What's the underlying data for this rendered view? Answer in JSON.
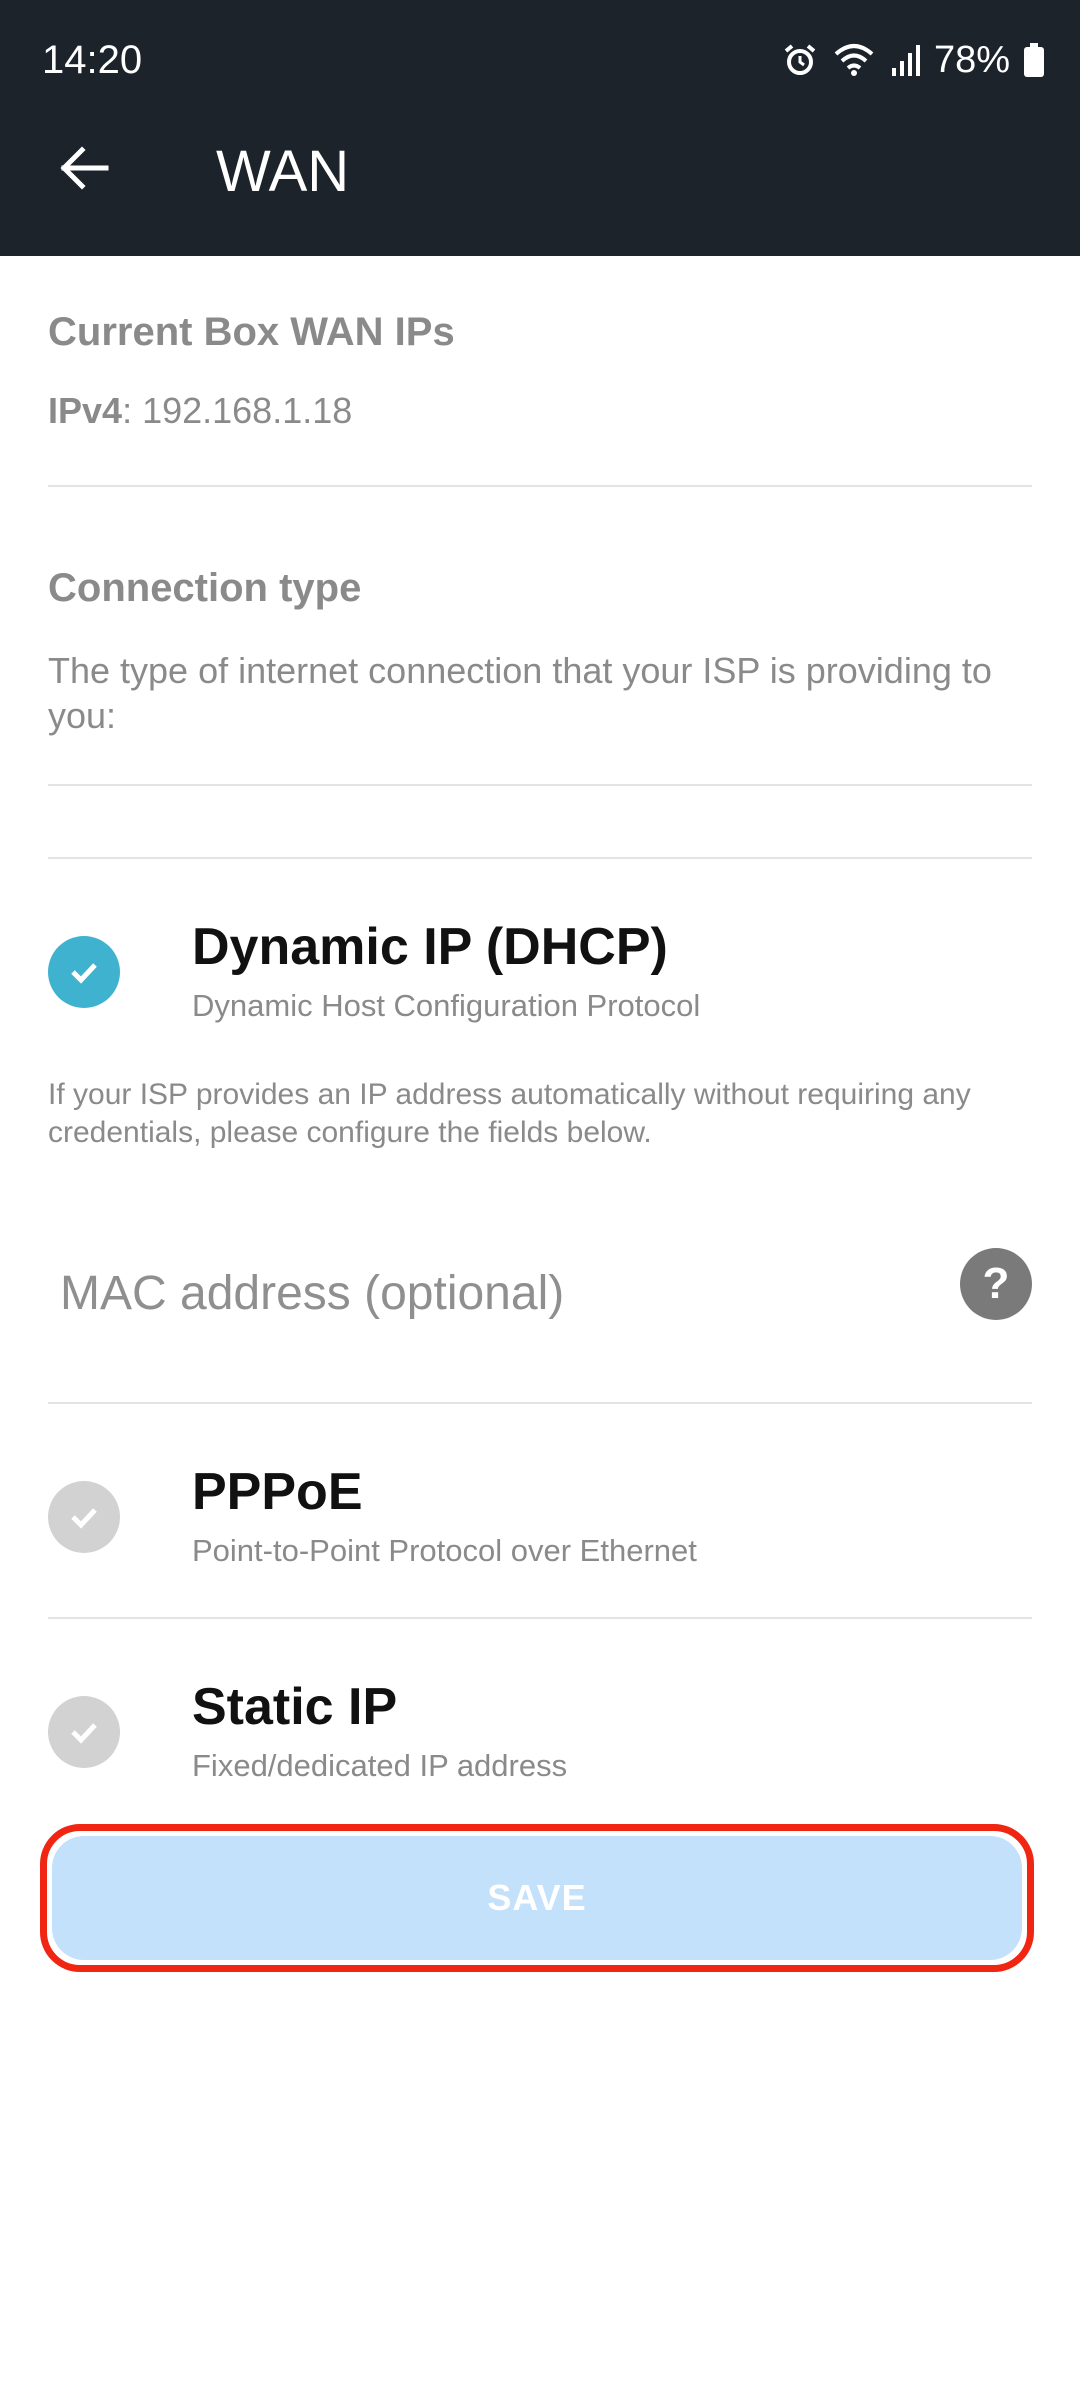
{
  "status_bar": {
    "time": "14:20",
    "battery": "78%",
    "icons": [
      "alarm-icon",
      "wifi-icon",
      "signal-icon",
      "battery-icon"
    ]
  },
  "app_bar": {
    "title": "WAN",
    "back_icon": "arrow-left-icon"
  },
  "wan_ips": {
    "title": "Current Box WAN IPs",
    "ipv4_label": "IPv4",
    "ipv4_value": ": 192.168.1.18"
  },
  "connection": {
    "title": "Connection type",
    "description": "The type of internet connection that your ISP is providing to you:"
  },
  "options": [
    {
      "title": "Dynamic IP (DHCP)",
      "subtitle": "Dynamic Host Configuration Protocol",
      "selected": true
    },
    {
      "title": "PPPoE",
      "subtitle": "Point-to-Point Protocol over Ethernet",
      "selected": false
    },
    {
      "title": "Static IP",
      "subtitle": "Fixed/dedicated IP address",
      "selected": false
    }
  ],
  "dhcp_info": "If your ISP provides an IP address automatically without requiring any credentials, please configure the fields below.",
  "mac_field": {
    "placeholder": "MAC address (optional)",
    "value": "",
    "help_icon": "?"
  },
  "save_button": {
    "label": "SAVE"
  },
  "colors": {
    "header_bg": "#1c232b",
    "accent": "#3fb2cf",
    "inactive_check": "#d2d2d2",
    "save_bg": "#c3e1fb",
    "highlight_outline": "#f02612"
  }
}
